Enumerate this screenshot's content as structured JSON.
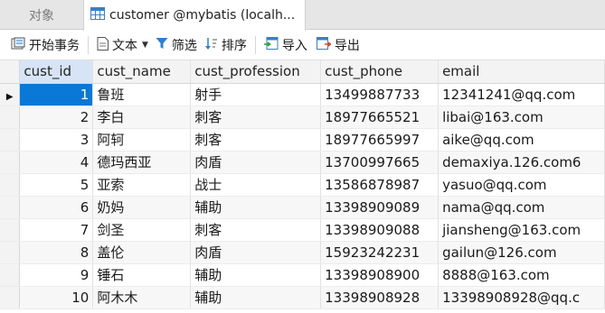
{
  "tabs": {
    "objects_label": "对象",
    "active_label": "customer @mybatis (localh..."
  },
  "toolbar": {
    "begin_transaction": "开始事务",
    "text": "文本",
    "filter": "筛选",
    "sort": "排序",
    "import": "导入",
    "export": "导出"
  },
  "grid": {
    "columns": [
      "cust_id",
      "cust_name",
      "cust_profession",
      "cust_phone",
      "email"
    ],
    "rows": [
      [
        "1",
        "鲁班",
        "射手",
        "13499887733",
        "12341241@qq.com"
      ],
      [
        "2",
        "李白",
        "刺客",
        "18977665521",
        "libai@163.com"
      ],
      [
        "3",
        "阿轲",
        "刺客",
        "18977665997",
        "aike@qq.com"
      ],
      [
        "4",
        "德玛西亚",
        "肉盾",
        "13700997665",
        "demaxiya.126.com6"
      ],
      [
        "5",
        "亚索",
        "战士",
        "13586878987",
        "yasuo@qq.com"
      ],
      [
        "6",
        "奶妈",
        "辅助",
        "13398909089",
        "nama@qq.com"
      ],
      [
        "7",
        "剑圣",
        "刺客",
        "13398909088",
        "jiansheng@163.com"
      ],
      [
        "8",
        "盖伦",
        "肉盾",
        "15923242231",
        "gailun@126.com"
      ],
      [
        "9",
        "锤石",
        "辅助",
        "13398908900",
        "8888@163.com"
      ],
      [
        "10",
        "阿木木",
        "辅助",
        "13398908928",
        "13398908928@qq.c"
      ]
    ],
    "selected_row": 0
  },
  "colors": {
    "selection": "#0a78d7",
    "header_bg": "#f3f3f3",
    "tab_bar_bg": "#e6e6e6"
  }
}
